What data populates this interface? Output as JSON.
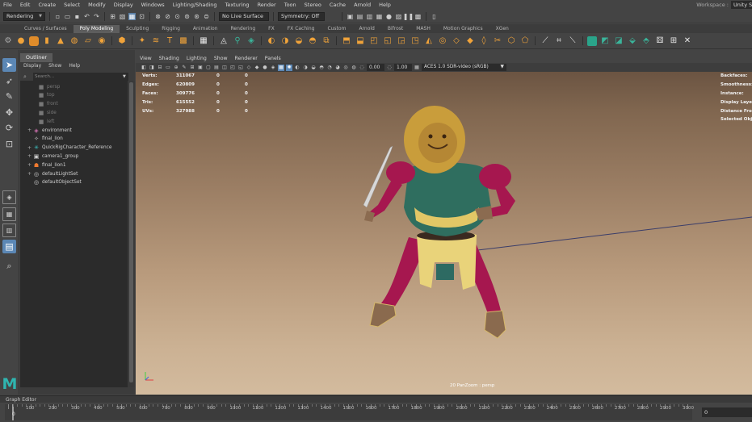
{
  "menubar": {
    "items": [
      "File",
      "Edit",
      "Create",
      "Select",
      "Modify",
      "Display",
      "Windows",
      "Lighting/Shading",
      "Texturing",
      "Render",
      "Toon",
      "Stereo",
      "Cache",
      "Arnold",
      "Help"
    ],
    "workspace_label": "Workspace :",
    "workspace_value": "Unity Su"
  },
  "statusline": {
    "menuset": "Rendering",
    "live_surface": "No Live Surface",
    "symmetry": "Symmetry: Off"
  },
  "shelf": {
    "tabs": [
      "Curves / Surfaces",
      "Poly Modeling",
      "Sculpting",
      "Rigging",
      "Animation",
      "Rendering",
      "FX",
      "FX Caching",
      "Custom",
      "Arnold",
      "Bifrost",
      "MASH",
      "Motion Graphics",
      "XGen"
    ],
    "active_tab": "Poly Modeling"
  },
  "outliner": {
    "tab_title": "Outliner",
    "menu": [
      "Display",
      "Show",
      "Help"
    ],
    "search_placeholder": "Search...",
    "items": [
      {
        "label": "persp",
        "icon": "camera-icon",
        "dim": true,
        "expand": ""
      },
      {
        "label": "top",
        "icon": "camera-icon",
        "dim": true,
        "expand": ""
      },
      {
        "label": "front",
        "icon": "camera-icon",
        "dim": true,
        "expand": ""
      },
      {
        "label": "side",
        "icon": "camera-icon",
        "dim": true,
        "expand": ""
      },
      {
        "label": "left",
        "icon": "camera-icon",
        "dim": true,
        "expand": ""
      },
      {
        "label": "environment",
        "icon": "mesh-icon",
        "dim": false,
        "expand": "+"
      },
      {
        "label": "final_lion",
        "icon": "curve-icon",
        "dim": false,
        "expand": ""
      },
      {
        "label": "QuickRigCharacter_Reference",
        "icon": "joint-icon",
        "dim": false,
        "expand": "+"
      },
      {
        "label": "camera1_group",
        "icon": "group-icon",
        "dim": false,
        "expand": "+"
      },
      {
        "label": "final_lion1",
        "icon": "character-icon",
        "dim": false,
        "expand": "+"
      },
      {
        "label": "defaultLightSet",
        "icon": "set-icon",
        "dim": false,
        "expand": "+"
      },
      {
        "label": "defaultObjectSet",
        "icon": "set-icon",
        "dim": false,
        "expand": ""
      }
    ]
  },
  "viewport": {
    "menu": [
      "View",
      "Shading",
      "Lighting",
      "Show",
      "Renderer",
      "Panels"
    ],
    "exposure": "0.00",
    "gamma": "1.00",
    "color_space": "ACES 1.0 SDR-video (sRGB)",
    "hud_left": [
      {
        "label": "Verts:",
        "v1": "311067",
        "v2": "0",
        "v3": "0"
      },
      {
        "label": "Edges:",
        "v1": "620809",
        "v2": "0",
        "v3": "0"
      },
      {
        "label": "Faces:",
        "v1": "309776",
        "v2": "0",
        "v3": "0"
      },
      {
        "label": "Tris:",
        "v1": "615552",
        "v2": "0",
        "v3": "0"
      },
      {
        "label": "UVs:",
        "v1": "327988",
        "v2": "0",
        "v3": "0"
      }
    ],
    "hud_right": [
      "Backfaces:",
      "Smoothness:",
      "Instance:",
      "Display Layer:",
      "Distance From",
      "Selected Objec"
    ],
    "camera_label": "20 PanZoom : persp"
  },
  "graph_editor": {
    "label": "Graph Editor"
  },
  "timeline": {
    "labels": [
      "1",
      "100",
      "200",
      "300",
      "400",
      "500",
      "600",
      "700",
      "800",
      "900",
      "1000",
      "1100",
      "1200",
      "1300",
      "1400",
      "1500",
      "1600",
      "1700",
      "1800",
      "1900",
      "2000",
      "2100",
      "2200",
      "2300",
      "2400",
      "2500",
      "2600",
      "2700",
      "2800",
      "2900",
      "3000"
    ],
    "current_frame": "0",
    "frame_field": "0"
  },
  "colors": {
    "selection_blue": "#5b87b5",
    "maya_teal": "#2fb5b0",
    "shelf_orange": "#f0a33a"
  }
}
